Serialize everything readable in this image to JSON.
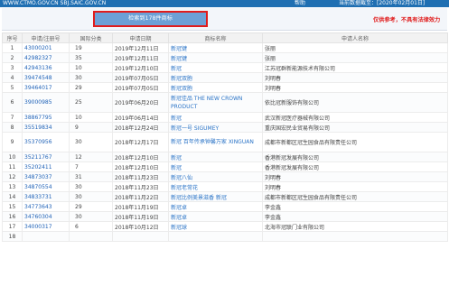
{
  "topbar": {
    "site": "WWW.CTMO.GOV.CN  SBJ.SAIC.GOV.CN",
    "nav": "帮助",
    "date_label": "当前数据截至：[2020年02月01日]"
  },
  "toolbar": {
    "count_button": "检索到178件商标",
    "disclaimer": "仅供参考，不具有法律效力"
  },
  "table": {
    "headers": [
      "序号",
      "申请/注册号",
      "国际分类",
      "申请日期",
      "商标名称",
      "申请人名称"
    ],
    "rows": [
      {
        "seq": "1",
        "regno": "43000201",
        "cls": "19",
        "date": "2019年12月11日",
        "mark": "新冠键",
        "applicant": "张丽"
      },
      {
        "seq": "2",
        "regno": "42982327",
        "cls": "35",
        "date": "2019年12月11日",
        "mark": "新冠键",
        "applicant": "张丽"
      },
      {
        "seq": "3",
        "regno": "42943136",
        "cls": "10",
        "date": "2019年12月10日",
        "mark": "新冠",
        "applicant": "江苏冠群新能源技术有限公司"
      },
      {
        "seq": "4",
        "regno": "39474548",
        "cls": "30",
        "date": "2019年07月05日",
        "mark": "新冠双胞",
        "applicant": "刘明春"
      },
      {
        "seq": "5",
        "regno": "39464017",
        "cls": "29",
        "date": "2019年07月05日",
        "mark": "新冠双胞",
        "applicant": "刘明春"
      },
      {
        "seq": "6",
        "regno": "39000985",
        "cls": "25",
        "date": "2019年06月20日",
        "mark": "新冠佳品 THE NEW CROWN PRODUCT",
        "applicant": "依比冠新服饰有限公司"
      },
      {
        "seq": "7",
        "regno": "38867795",
        "cls": "10",
        "date": "2019年06月14日",
        "mark": "新冠",
        "applicant": "武汉新冠医疗器械有限公司"
      },
      {
        "seq": "8",
        "regno": "35519834",
        "cls": "9",
        "date": "2018年12月24日",
        "mark": "新冠一号 SIGUMEY",
        "applicant": "重庆国宏民业贸易有限公司"
      },
      {
        "seq": "9",
        "regno": "35370956",
        "cls": "30",
        "date": "2018年12月17日",
        "mark": "新冠 百年传承钟馨万家 XINGUAN",
        "applicant": "成都市新都区冠生园食品有限责任公司"
      },
      {
        "seq": "10",
        "regno": "35211767",
        "cls": "12",
        "date": "2018年12月10日",
        "mark": "新冠",
        "applicant": "香港新冠发展有限公司"
      },
      {
        "seq": "11",
        "regno": "35202411",
        "cls": "7",
        "date": "2018年12月10日",
        "mark": "新冠",
        "applicant": "香港新冠发展有限公司"
      },
      {
        "seq": "12",
        "regno": "34873037",
        "cls": "31",
        "date": "2018年11月23日",
        "mark": "新冠八仙",
        "applicant": "刘明春"
      },
      {
        "seq": "13",
        "regno": "34870554",
        "cls": "30",
        "date": "2018年11月23日",
        "mark": "新冠老常花",
        "applicant": "刘明春"
      },
      {
        "seq": "14",
        "regno": "34833731",
        "cls": "30",
        "date": "2018年11月22日",
        "mark": "新冠比例美景滋香 新冠",
        "applicant": "成都市新都区冠生园食品有限责任公司"
      },
      {
        "seq": "15",
        "regno": "34773643",
        "cls": "29",
        "date": "2018年11月19日",
        "mark": "新冠卓",
        "applicant": "李金鑫"
      },
      {
        "seq": "16",
        "regno": "34760304",
        "cls": "30",
        "date": "2018年11月19日",
        "mark": "新冠卓",
        "applicant": "李金鑫"
      },
      {
        "seq": "17",
        "regno": "34000317",
        "cls": "6",
        "date": "2018年10月12日",
        "mark": "新冠球",
        "applicant": "北海市冠联门业有限公司"
      },
      {
        "seq": "18",
        "regno": "",
        "cls": "",
        "date": "",
        "mark": "",
        "applicant": ""
      }
    ]
  }
}
